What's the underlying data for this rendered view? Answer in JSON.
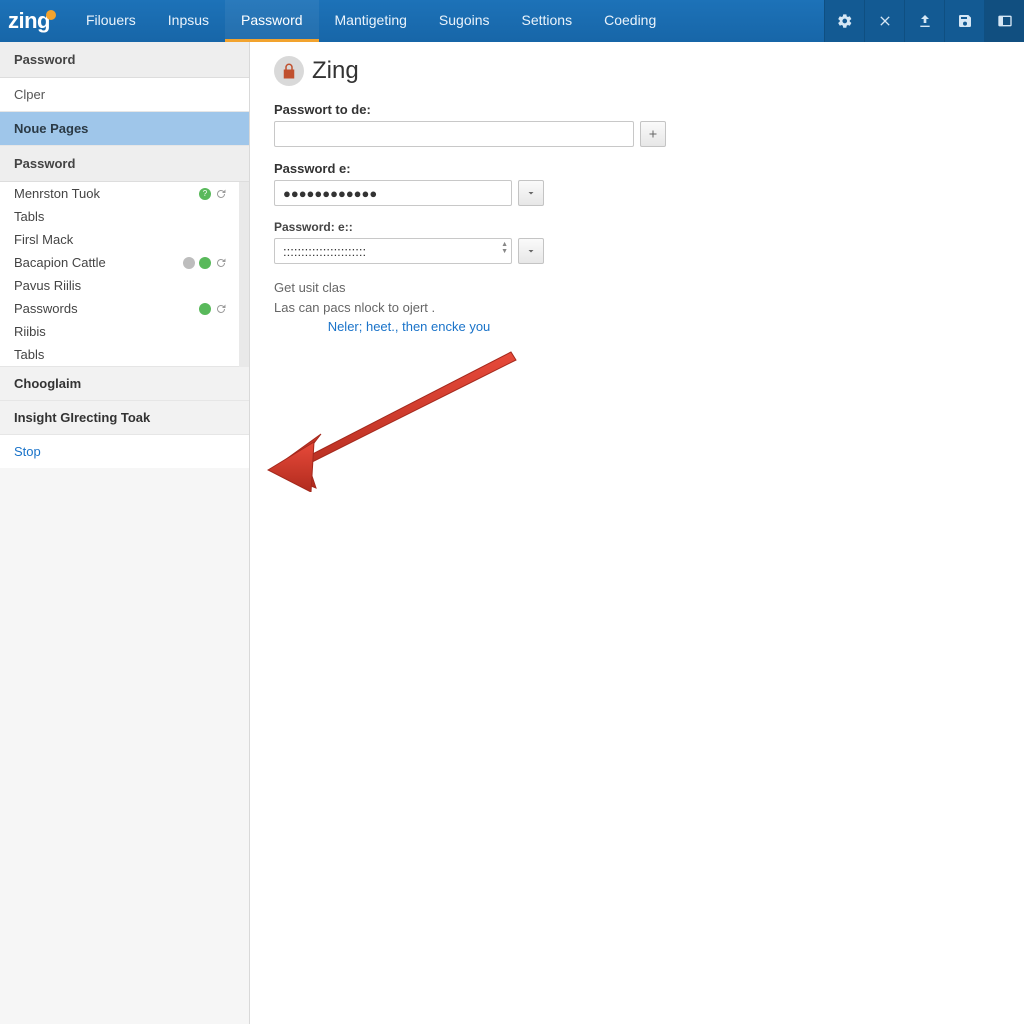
{
  "brand": "zing",
  "topnav": {
    "items": [
      {
        "label": "Filouers"
      },
      {
        "label": "Inpsus"
      },
      {
        "label": "Password",
        "active": true
      },
      {
        "label": "Mantigeting"
      },
      {
        "label": "Sugoins"
      },
      {
        "label": "Settions"
      },
      {
        "label": "Coeding"
      }
    ]
  },
  "sidebar": {
    "section1_title": "Password",
    "section1_items": [
      {
        "label": "Clper"
      },
      {
        "label": "Noue Pages",
        "selected": true
      }
    ],
    "section2_title": "Password",
    "section2_items": [
      {
        "label": "Menrston Tuok",
        "badges": [
          "green",
          "cycle"
        ]
      },
      {
        "label": "Tabls"
      },
      {
        "label": "Firsl Mack"
      },
      {
        "label": "Bacapion Cattle",
        "badges": [
          "gray",
          "green",
          "cycle"
        ]
      },
      {
        "label": "Pavus Riilis"
      },
      {
        "label": "Passwords",
        "badges": [
          "green",
          "cycle"
        ]
      },
      {
        "label": "Riibis"
      },
      {
        "label": "Tabls"
      }
    ],
    "section3": "Chooglaim",
    "section4": "Insight GIrecting Toak",
    "stop": "Stop"
  },
  "main": {
    "title": "Zing",
    "field1_label": "Passwort to de:",
    "field1_value": "",
    "field2_label": "Password e:",
    "field2_value": "●●●●●●●●●●●●",
    "field3_label": "Password: e::",
    "field3_value": ":::::::::::::::::::::::",
    "help1": "Get usit clas",
    "help2": "Las can pacs nlock to ojert .",
    "help_link": "Neler; heet., then encke you"
  }
}
